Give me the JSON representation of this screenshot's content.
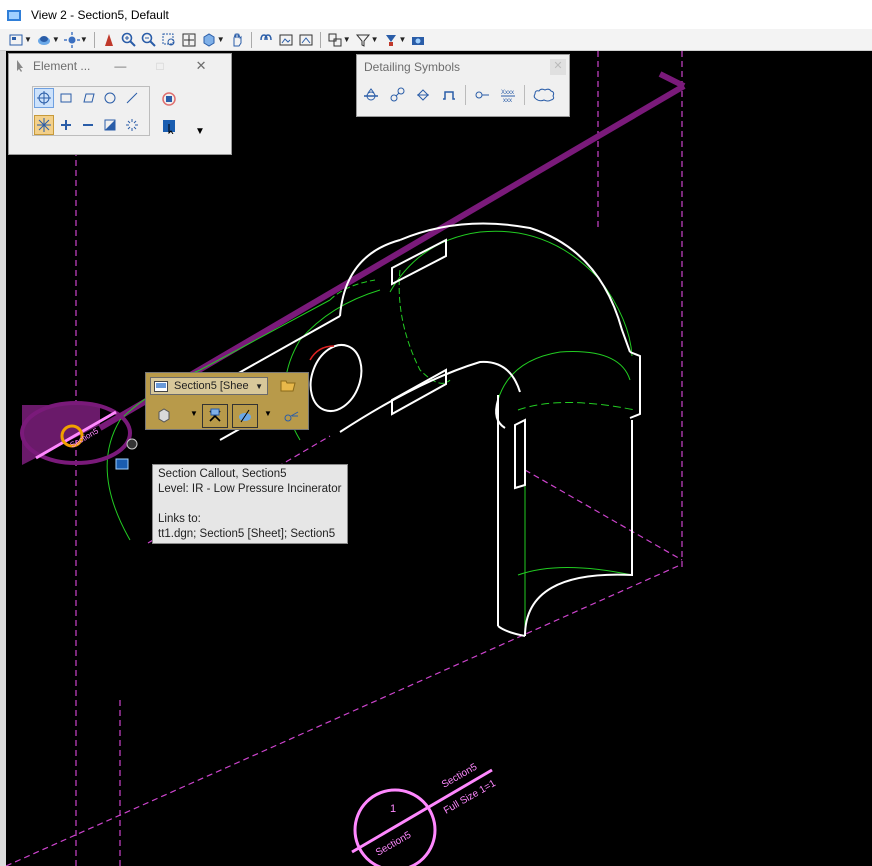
{
  "window": {
    "title": "View 2 - Section5, Default"
  },
  "element_panel": {
    "title": "Element ...",
    "minimize": "—",
    "maximize": "□",
    "close": "✕"
  },
  "detailing_panel": {
    "title": "Detailing Symbols"
  },
  "callout_minibar": {
    "selector_text": "Section5 [Shee"
  },
  "tooltip": {
    "line1": "Section Callout, Section5",
    "line2": "Level: IR - Low Pressure Incinerator",
    "line3": "Links to:",
    "line4": "tt1.dgn; Section5 [Sheet]; Section5"
  },
  "drawing": {
    "callout_label": "Section5",
    "bubble_number": "1",
    "bubble_label": "Section5",
    "tag_title": "Section5",
    "tag_scale": "Full Size 1=1"
  },
  "colors": {
    "magenta": "#cc44cc",
    "purple": "#7a1a7a",
    "green": "#22cc22",
    "white": "#ffffff",
    "pink": "#ff88ff"
  }
}
